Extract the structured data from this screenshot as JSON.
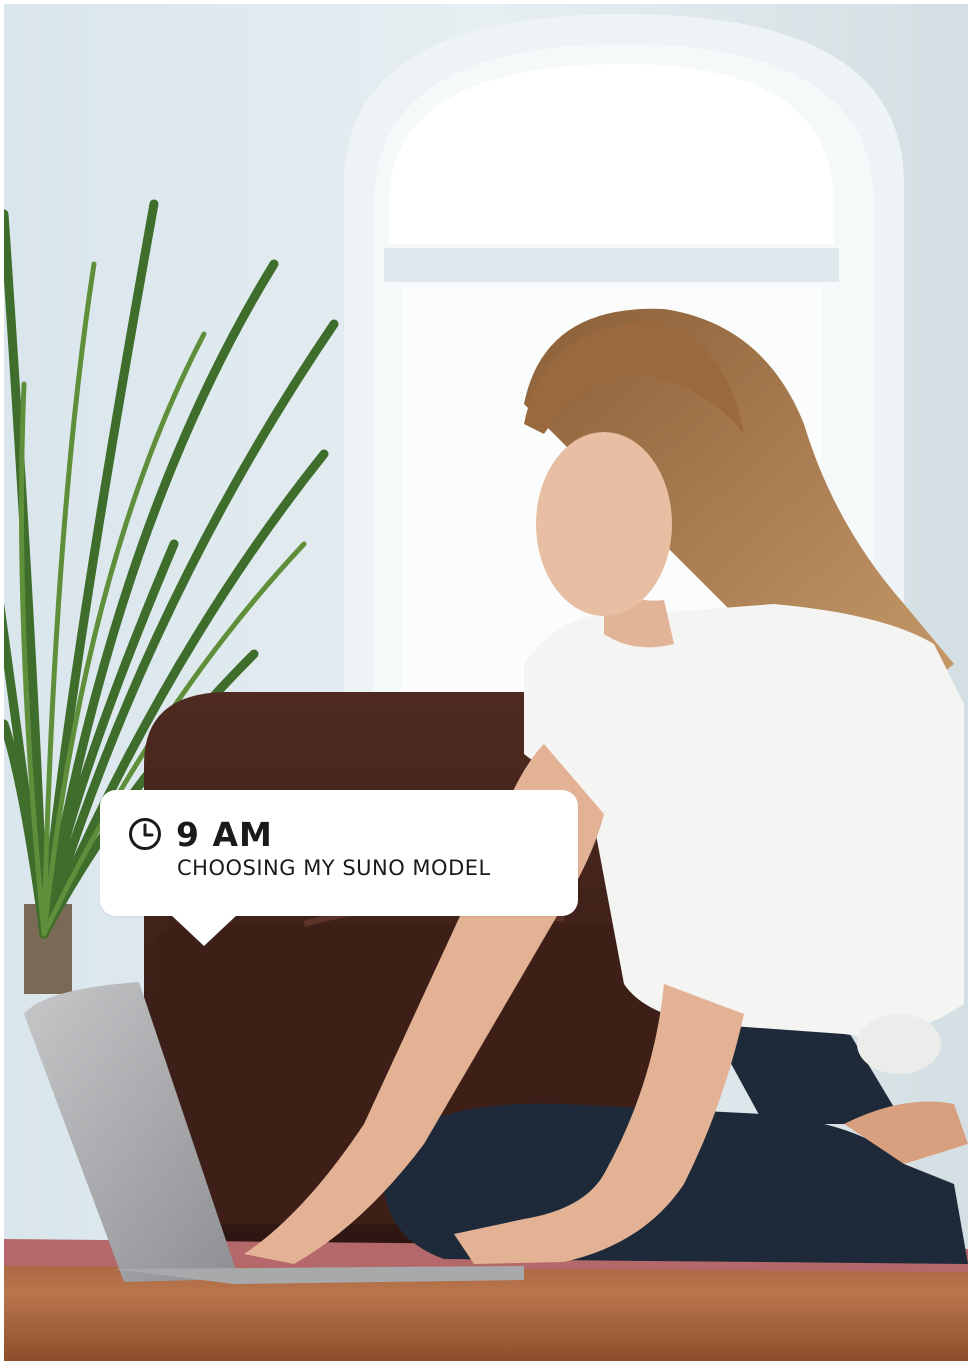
{
  "bubble": {
    "time": "9 AM",
    "caption": "CHOOSING MY SUNO MODEL"
  },
  "icons": {
    "clock": "clock-icon"
  },
  "colors": {
    "bubble_bg": "#ffffff",
    "text": "#1a1a1a"
  }
}
